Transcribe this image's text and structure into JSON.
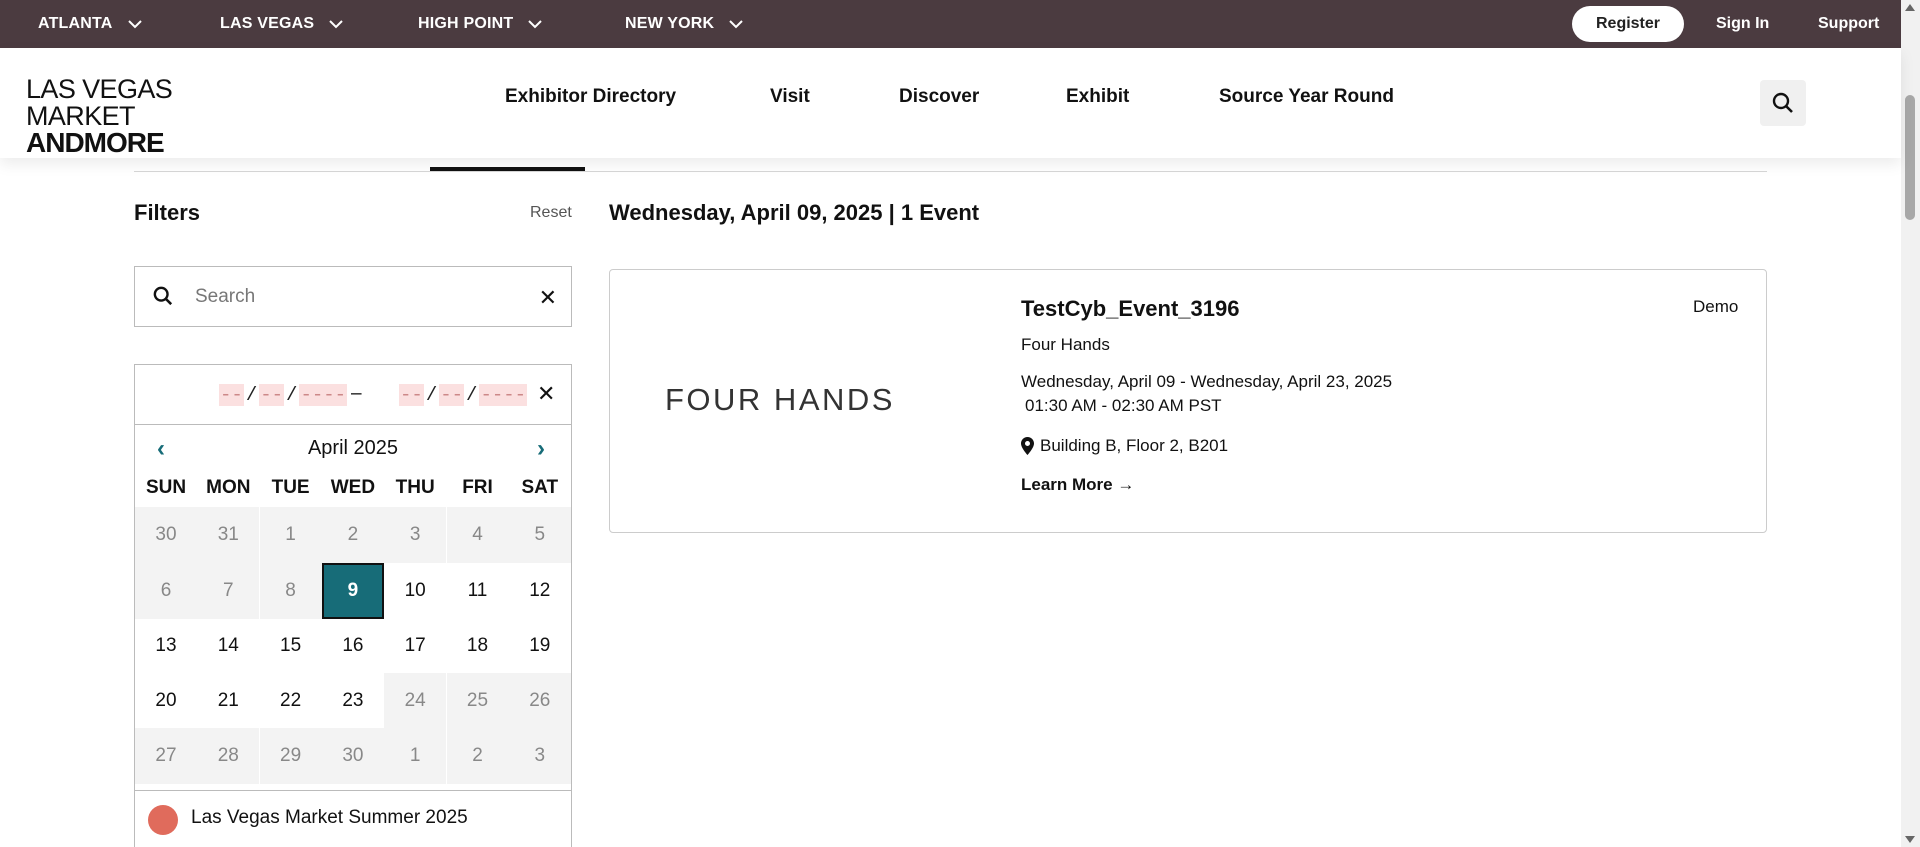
{
  "topbar": {
    "markets": [
      "ATLANTA",
      "LAS VEGAS",
      "HIGH POINT",
      "NEW YORK"
    ],
    "register_label": "Register",
    "signin_label": "Sign In",
    "support_label": "Support",
    "background_color": "#4b3b40"
  },
  "header": {
    "logo_line1": "LAS VEGAS MARKET",
    "logo_line2": "ANDMORE",
    "nav": [
      "Exhibitor Directory",
      "Visit",
      "Discover",
      "Exhibit",
      "Source Year Round"
    ],
    "search_icon": "search-icon"
  },
  "filters": {
    "title": "Filters",
    "reset_label": "Reset",
    "search_placeholder": "Search",
    "search_value": "",
    "date_from": {
      "mm": "--",
      "dd": "--",
      "yyyy": "----"
    },
    "date_to": {
      "mm": "--",
      "dd": "--",
      "yyyy": "----"
    },
    "range_separator": "–",
    "calendar": {
      "month_label": "April 2025",
      "prev": "‹",
      "next": "›",
      "weekdays": [
        "SUN",
        "MON",
        "TUE",
        "WED",
        "THU",
        "FRI",
        "SAT"
      ],
      "weeks": [
        [
          [
            "30",
            "out"
          ],
          [
            "31",
            "out"
          ],
          [
            "1",
            "out"
          ],
          [
            "2",
            "out"
          ],
          [
            "3",
            "out"
          ],
          [
            "4",
            "out"
          ],
          [
            "5",
            "out"
          ]
        ],
        [
          [
            "6",
            "out"
          ],
          [
            "7",
            "out"
          ],
          [
            "8",
            "out"
          ],
          [
            "9",
            "sel"
          ],
          [
            "10",
            "in"
          ],
          [
            "11",
            "in"
          ],
          [
            "12",
            "in"
          ]
        ],
        [
          [
            "13",
            "in"
          ],
          [
            "14",
            "in"
          ],
          [
            "15",
            "in"
          ],
          [
            "16",
            "in"
          ],
          [
            "17",
            "in"
          ],
          [
            "18",
            "in"
          ],
          [
            "19",
            "in"
          ]
        ],
        [
          [
            "20",
            "in"
          ],
          [
            "21",
            "in"
          ],
          [
            "22",
            "in"
          ],
          [
            "23",
            "in"
          ],
          [
            "24",
            "out"
          ],
          [
            "25",
            "out"
          ],
          [
            "26",
            "out"
          ]
        ],
        [
          [
            "27",
            "out"
          ],
          [
            "28",
            "out"
          ],
          [
            "29",
            "out"
          ],
          [
            "30",
            "out"
          ],
          [
            "1",
            "out"
          ],
          [
            "2",
            "out"
          ],
          [
            "3",
            "out"
          ]
        ]
      ],
      "selected_color": "#176c78"
    },
    "legend": {
      "label": "Las Vegas Market Summer 2025",
      "color": "#e06b5c"
    }
  },
  "events": {
    "heading": "Wednesday, April 09, 2025 | 1 Event",
    "items": [
      {
        "logo_text": "FOUR HANDS",
        "title": "TestCyb_Event_3196",
        "tag": "Demo",
        "exhibitor": "Four Hands",
        "dates": "Wednesday, April 09 - Wednesday, April 23, 2025",
        "time": "01:30 AM - 02:30 AM PST",
        "location": "Building B, Floor 2, B201",
        "learn_more": "Learn More →"
      }
    ]
  }
}
